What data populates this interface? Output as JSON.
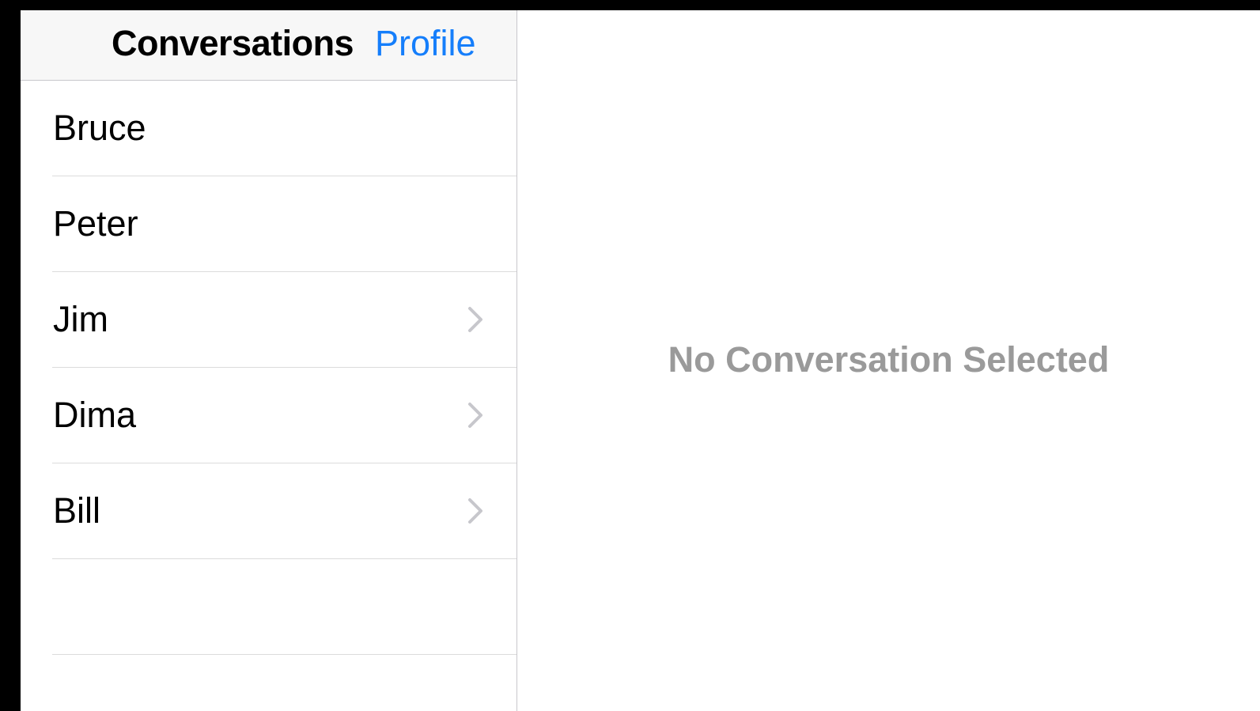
{
  "navbar": {
    "title": "Conversations",
    "profile_label": "Profile"
  },
  "conversations": [
    {
      "name": "Bruce",
      "has_chevron": false
    },
    {
      "name": "Peter",
      "has_chevron": false
    },
    {
      "name": "Jim",
      "has_chevron": true
    },
    {
      "name": "Dima",
      "has_chevron": true
    },
    {
      "name": "Bill",
      "has_chevron": true
    }
  ],
  "detail": {
    "placeholder": "No Conversation Selected"
  },
  "colors": {
    "accent": "#157efb",
    "placeholder_text": "#9a9a9a",
    "navbar_bg": "#f7f7f7",
    "separator": "#dcdcdc",
    "chevron": "#c7c7cc"
  },
  "icons": {
    "disclosure": "chevron-right-icon"
  }
}
